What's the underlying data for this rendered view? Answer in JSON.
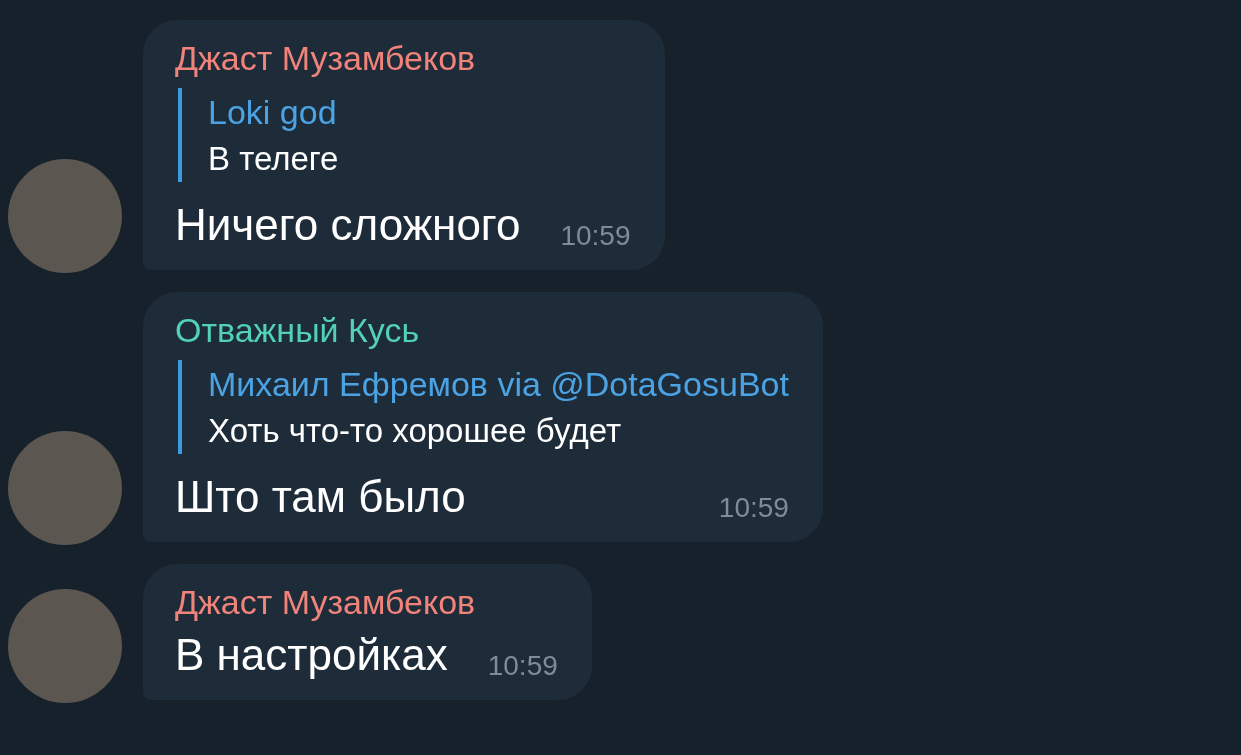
{
  "messages": [
    {
      "sender": "Джаст Музамбеков",
      "color": "#f0837a",
      "reply": {
        "author": "Loki god",
        "text": "В телеге"
      },
      "text": "Ничего сложного",
      "time": "10:59"
    },
    {
      "sender": "Отважный Кусь",
      "color": "#52d0b8",
      "reply": {
        "author": "Михаил Ефремов via @DotaGosuBot",
        "text": "Хоть что-то хорошее будет"
      },
      "text": "Што там было",
      "time": "10:59"
    },
    {
      "sender": "Джаст Музамбеков",
      "color": "#f0837a",
      "text": "В настройках",
      "time": "10:59"
    }
  ]
}
